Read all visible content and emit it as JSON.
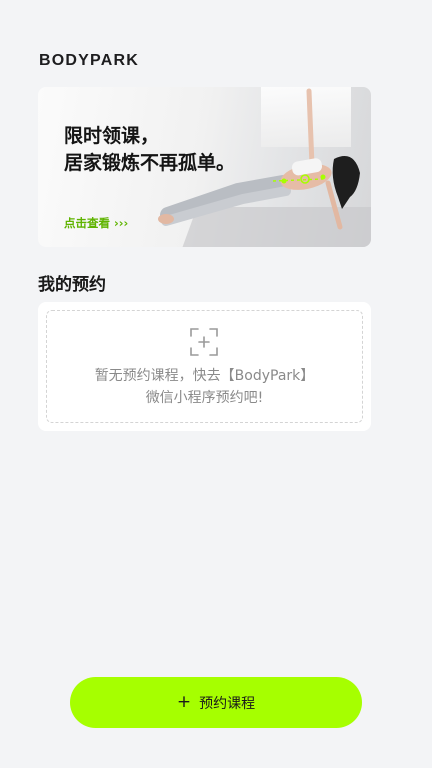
{
  "header": {
    "logo_text": "BODYPARK"
  },
  "banner": {
    "title_line1": "限时领课，",
    "title_line2": "居家锻炼不再孤单。",
    "cta_label": "点击查看 ›››",
    "accent_color": "#a6ff00"
  },
  "reservations": {
    "section_title": "我的预约",
    "empty_icon": "scan-add-icon",
    "empty_line1": "暂无预约课程，快去【BodyPark】",
    "empty_line2": "微信小程序预约吧!"
  },
  "footer": {
    "book_icon": "plus-icon",
    "book_icon_glyph": "+",
    "book_label": "预约课程",
    "button_color": "#a6ff00"
  }
}
